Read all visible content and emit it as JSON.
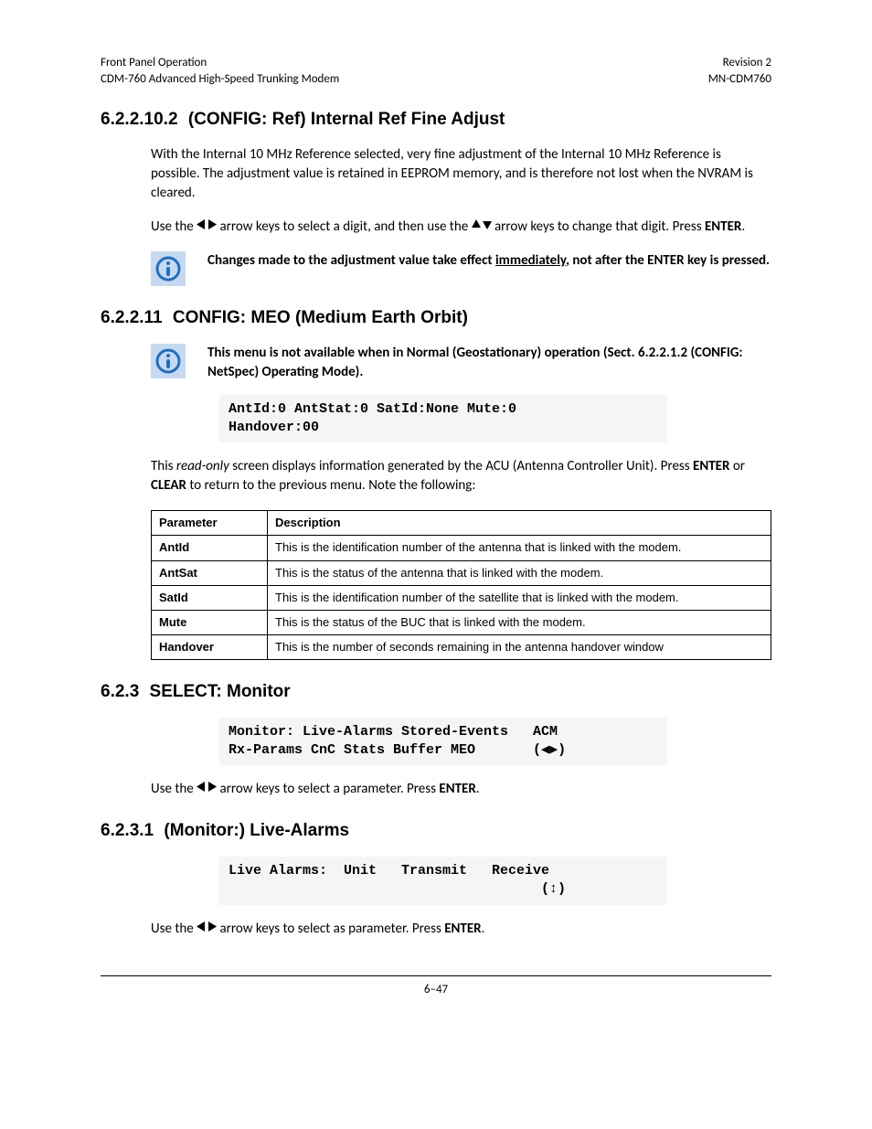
{
  "header": {
    "left1": "Front Panel Operation",
    "left2": "CDM-760 Advanced High-Speed Trunking Modem",
    "right1": "Revision 2",
    "right2": "MN-CDM760"
  },
  "s1": {
    "num": "6.2.2.10.2",
    "title": "(CONFIG: Ref) Internal Ref Fine Adjust",
    "p1": "With the Internal 10 MHz Reference selected, very fine adjustment of the Internal 10 MHz Reference is possible. The adjustment value is retained in EEPROM memory, and is therefore not lost when the NVRAM is cleared.",
    "p2a": "Use the ",
    "p2b": " arrow keys to select a digit, and then use the ",
    "p2c": " arrow keys to change that digit. Press ",
    "p2d": "ENTER",
    "p2e": ".",
    "note_a": "Changes made to the adjustment value take effect ",
    "note_b": "immediately",
    "note_c": ", not after the ENTER key is pressed."
  },
  "s2": {
    "num": "6.2.2.11",
    "title": "CONFIG: MEO (Medium Earth Orbit)",
    "note": "This menu is not available when in Normal (Geostationary) operation (Sect. 6.2.2.1.2 (CONFIG: NetSpec) Operating Mode).",
    "code": "AntId:0 AntStat:0 SatId:None Mute:0\nHandover:00",
    "p1a": "This ",
    "p1b": "read-only",
    "p1c": " screen displays information generated by the ACU (Antenna Controller Unit). Press ",
    "p1d": "ENTER",
    "p1e": " or ",
    "p1f": "CLEAR",
    "p1g": " to return to the previous menu. Note the following:",
    "th1": "Parameter",
    "th2": "Description",
    "rows": [
      {
        "p": "AntId",
        "d": "This is the identification number of the antenna that is linked with the modem."
      },
      {
        "p": "AntSat",
        "d": "This is the status of the antenna that is linked with the modem."
      },
      {
        "p": "SatId",
        "d": "This is the identification number of the satellite that is linked with the modem."
      },
      {
        "p": "Mute",
        "d": "This is the status of the BUC that is linked with the modem."
      },
      {
        "p": "Handover",
        "d": "This is the number of seconds remaining in the antenna handover window"
      }
    ]
  },
  "s3": {
    "num": "6.2.3",
    "title": "SELECT: Monitor",
    "code": "Monitor: Live-Alarms Stored-Events   ACM\nRx-Params CnC Stats Buffer MEO       (◀▶)",
    "p1a": "Use the ",
    "p1b": " arrow keys to select a parameter. Press ",
    "p1c": "ENTER",
    "p1d": "."
  },
  "s4": {
    "num": "6.2.3.1",
    "title": "(Monitor:) Live-Alarms",
    "code": "Live Alarms:  Unit   Transmit   Receive\n                                      (↕)",
    "p1a": "Use the ",
    "p1b": " arrow keys to select as parameter. Press ",
    "p1c": "ENTER",
    "p1d": "."
  },
  "footer": "6–47"
}
